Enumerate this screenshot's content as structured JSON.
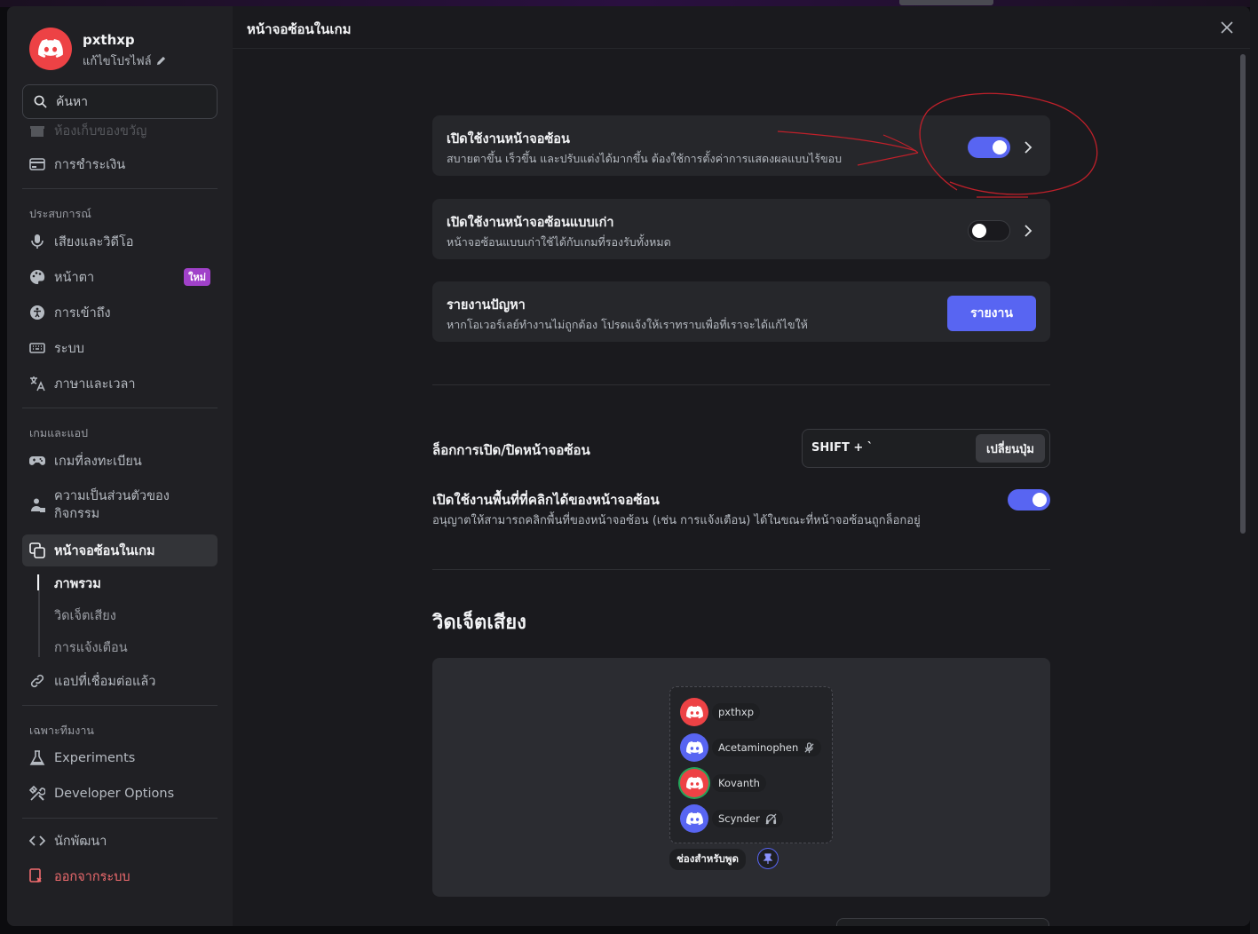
{
  "profile": {
    "username": "pxthxp",
    "edit_label": "แก้ไขโปรไฟล์"
  },
  "search": {
    "placeholder": "ค้นหา"
  },
  "sidebar": {
    "gift_inventory": "ห้องเก็บของขวัญ",
    "billing": "การชำระเงิน",
    "section_experience": "ประสบการณ์",
    "voice_video": "เสียงและวิดีโอ",
    "appearance": "หน้าตา",
    "new_badge": "ใหม่",
    "accessibility": "การเข้าถึง",
    "system": "ระบบ",
    "language_time": "ภาษาและเวลา",
    "section_games_apps": "เกมและแอป",
    "registered_games": "เกมที่ลงทะเบียน",
    "activity_privacy_line1": "ความเป็นส่วนตัวของ",
    "activity_privacy_line2": "กิจกรรม",
    "game_overlay": "หน้าจอซ้อนในเกม",
    "sub_overview": "ภาพรวม",
    "sub_voice_widget": "วิดเจ็ตเสียง",
    "sub_notifications": "การแจ้งเตือน",
    "connected_apps": "แอปที่เชื่อมต่อแล้ว",
    "section_staff": "เฉพาะทีมงาน",
    "experiments": "Experiments",
    "developer_options": "Developer Options",
    "developer": "นักพัฒนา",
    "logout": "ออกจากระบบ"
  },
  "header": {
    "title": "หน้าจอซ้อนในเกม"
  },
  "overlay_settings": {
    "enable_title": "เปิดใช้งานหน้าจอซ้อน",
    "enable_desc": "สบายตาขึ้น เร็วขึ้น และปรับแต่งได้มากขึ้น ต้องใช้การตั้งค่าการแสดงผลแบบไร้ขอบ",
    "enable_on": true,
    "legacy_title": "เปิดใช้งานหน้าจอซ้อนแบบเก่า",
    "legacy_desc": "หน้าจอซ้อนแบบเก่าใช้ได้กับเกมที่รองรับทั้งหมด",
    "legacy_on": false,
    "report_title": "รายงานปัญหา",
    "report_desc": "หากโอเวอร์เลย์ทำงานไม่ถูกต้อง โปรดแจ้งให้เราทราบเพื่อที่เราจะได้แก้ไขให้",
    "report_button": "รายงาน"
  },
  "keybind": {
    "label": "ล็อกการเปิด/ปิดหน้าจอซ้อน",
    "value": "SHIFT + `",
    "change_button": "เปลี่ยนปุ่ม"
  },
  "clickable_zones": {
    "title": "เปิดใช้งานพื้นที่ที่คลิกได้ของหน้าจอซ้อน",
    "desc": "อนุญาตให้สามารถคลิกพื้นที่ของหน้าจอซ้อน (เช่น การแจ้งเตือน) ได้ในขณะที่หน้าจอซ้อนถูกล็อกอยู่",
    "on": true
  },
  "voice_widget": {
    "heading": "วิดเจ็ตเสียง",
    "members": [
      {
        "name": "pxthxp",
        "avatar_color": "#ed4245",
        "status_icon": ""
      },
      {
        "name": "Acetaminophen",
        "avatar_color": "#5865f2",
        "status_icon": "mic-muted-icon"
      },
      {
        "name": "Kovanth",
        "avatar_color": "#ed4245",
        "status_icon": ""
      },
      {
        "name": "Scynder",
        "avatar_color": "#5865f2",
        "status_icon": "headphones-deafened-icon"
      }
    ],
    "channel_label": "ช่องสำหรับพูด"
  },
  "colors": {
    "accent": "#5865f2",
    "danger": "#ed4245",
    "annotation": "#c0202a"
  }
}
